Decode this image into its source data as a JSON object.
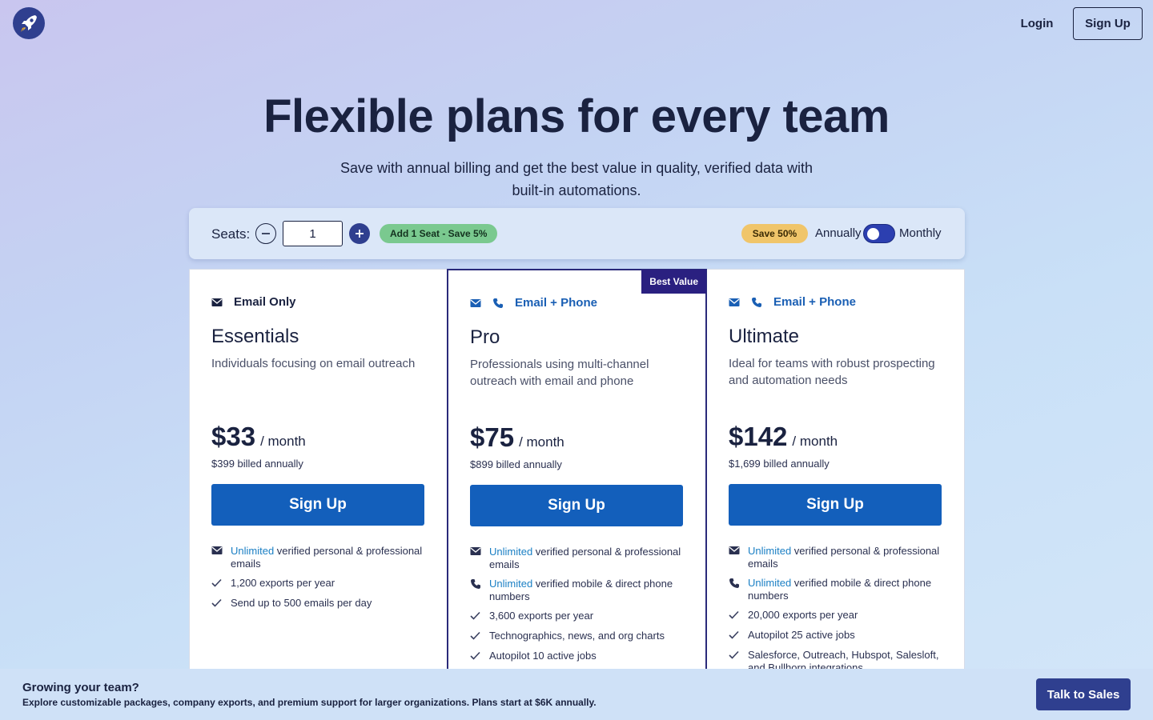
{
  "nav": {
    "login_label": "Login",
    "signup_label": "Sign Up",
    "logo_icon": "rocket-icon"
  },
  "hero": {
    "title": "Flexible plans for every team",
    "subtitle": "Save with annual billing and get the best value in quality, verified data with built-in automations."
  },
  "seats": {
    "label": "Seats:",
    "value": "1",
    "add_seat_badge": "Add 1 Seat - Save 5%",
    "save_badge": "Save 50%",
    "annually_label": "Annually",
    "monthly_label": "Monthly"
  },
  "plans": [
    {
      "channel": "Email Only",
      "channel_icons": [
        "envelope-icon"
      ],
      "name": "Essentials",
      "description": "Individuals focusing on email outreach",
      "price": "$33",
      "per": "/ month",
      "billed": "$399 billed annually",
      "cta": "Sign Up",
      "features": [
        {
          "icon": "envelope-icon",
          "highlight": "Unlimited",
          "text": " verified personal & professional emails"
        },
        {
          "icon": "check-icon",
          "highlight": "",
          "text": "1,200 exports per year"
        },
        {
          "icon": "check-icon",
          "highlight": "",
          "text": "Send up to 500 emails per day"
        }
      ]
    },
    {
      "badge": "Best Value",
      "channel": "Email + Phone",
      "channel_icons": [
        "envelope-icon",
        "phone-icon"
      ],
      "name": "Pro",
      "description": "Professionals using multi-channel outreach with email and phone",
      "price": "$75",
      "per": "/ month",
      "billed": "$899 billed annually",
      "cta": "Sign Up",
      "features": [
        {
          "icon": "envelope-icon",
          "highlight": "Unlimited",
          "text": " verified personal & professional emails"
        },
        {
          "icon": "phone-icon",
          "highlight": "Unlimited",
          "text": " verified mobile & direct phone numbers"
        },
        {
          "icon": "check-icon",
          "highlight": "",
          "text": "3,600 exports per year"
        },
        {
          "icon": "check-icon",
          "highlight": "",
          "text": "Technographics, news, and org charts"
        },
        {
          "icon": "check-icon",
          "highlight": "",
          "text": "Autopilot 10 active jobs"
        }
      ]
    },
    {
      "channel": "Email + Phone",
      "channel_icons": [
        "envelope-icon",
        "phone-icon"
      ],
      "name": "Ultimate",
      "description": "Ideal for teams with robust prospecting and automation needs",
      "price": "$142",
      "per": "/ month",
      "billed": "$1,699 billed annually",
      "cta": "Sign Up",
      "features": [
        {
          "icon": "envelope-icon",
          "highlight": "Unlimited",
          "text": " verified personal & professional emails"
        },
        {
          "icon": "phone-icon",
          "highlight": "Unlimited",
          "text": " verified mobile & direct phone numbers"
        },
        {
          "icon": "check-icon",
          "highlight": "",
          "text": "20,000 exports per year"
        },
        {
          "icon": "check-icon",
          "highlight": "",
          "text": "Autopilot 25 active jobs"
        },
        {
          "icon": "check-icon",
          "highlight": "",
          "text": "Salesforce, Outreach, Hubspot, Salesloft, and Bullhorn integrations"
        }
      ]
    }
  ],
  "footer": {
    "title": "Growing your team?",
    "text": "Explore customizable packages, company exports, and premium support for larger organizations. Plans start at $6K annually.",
    "cta": "Talk to Sales"
  },
  "colors": {
    "primary": "#135fbb",
    "navy": "#2f3f8f",
    "badge_green": "#7ac98f",
    "badge_yellow": "#f0c56a",
    "best_value": "#2a2080",
    "highlight": "#1a7fc4"
  }
}
